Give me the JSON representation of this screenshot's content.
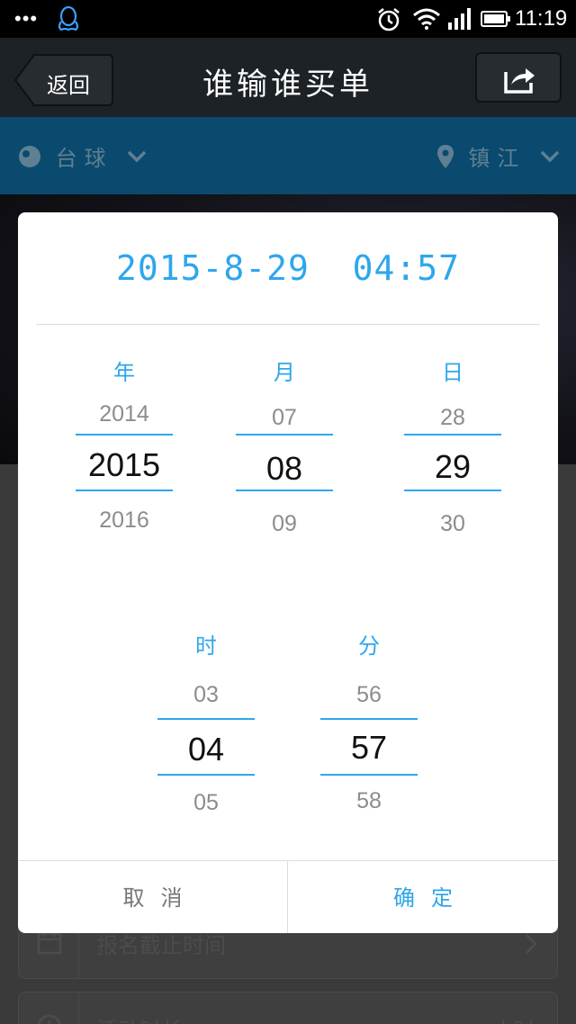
{
  "status_bar": {
    "dots": "•••",
    "time": "11:19",
    "icons": [
      "qq-penguin-icon",
      "alarm-icon",
      "wifi-icon",
      "signal-icon",
      "battery-icon"
    ]
  },
  "header": {
    "back_label": "返回",
    "title": "谁输谁买单",
    "share_icon": "share-icon"
  },
  "filter": {
    "category": "台球",
    "city": "镇江"
  },
  "form": {
    "deadline_label": "报名截止时间",
    "duration_label": "活动时长",
    "duration_unit": "小时"
  },
  "dialog": {
    "title": "2015-8-29  04:57",
    "columns": {
      "year": {
        "label": "年",
        "prev": "2014",
        "current": "2015",
        "next": "2016"
      },
      "month": {
        "label": "月",
        "prev": "07",
        "current": "08",
        "next": "09"
      },
      "day": {
        "label": "日",
        "prev": "28",
        "current": "29",
        "next": "30"
      },
      "hour": {
        "label": "时",
        "prev": "03",
        "current": "04",
        "next": "05"
      },
      "minute": {
        "label": "分",
        "prev": "56",
        "current": "57",
        "next": "58"
      }
    },
    "cancel_label": "取消",
    "confirm_label": "确定"
  },
  "colors": {
    "accent": "#2ea6ec",
    "header_bg": "#1c2226",
    "filter_bg": "#0a4a6e"
  }
}
